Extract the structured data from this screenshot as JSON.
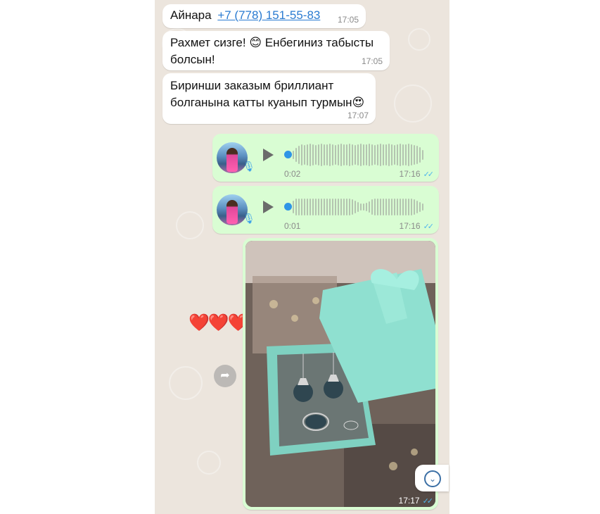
{
  "messages": [
    {
      "sender": "Айнара",
      "phone": "+7 (778) 151-55-83",
      "time": "17:05"
    },
    {
      "text_line1": "Рахмет сизге! 😊 Енбегиниз табысты",
      "text_line2": "болсын!",
      "time": "17:05"
    },
    {
      "text_line1": "Биринши заказым бриллиант",
      "text_line2": "болганына катты куанып турмын😍",
      "time": "17:07"
    }
  ],
  "voice_notes": [
    {
      "duration": "0:02",
      "time": "17:16"
    },
    {
      "duration": "0:01",
      "time": "17:16"
    }
  ],
  "photo_message": {
    "time": "17:17"
  },
  "reaction": "❤️❤️❤️",
  "icons": {
    "play": "play-icon",
    "mic": "microphone-icon",
    "read_receipt": "double-check-icon",
    "forward": "forward-icon",
    "scroll_down": "chevron-down-icon"
  },
  "colors": {
    "incoming_bubble": "#ffffff",
    "outgoing_bubble": "#d9fdd3",
    "chat_background": "#ece5dd",
    "link": "#2a7bd1",
    "read_ticks": "#4fb6ec"
  }
}
